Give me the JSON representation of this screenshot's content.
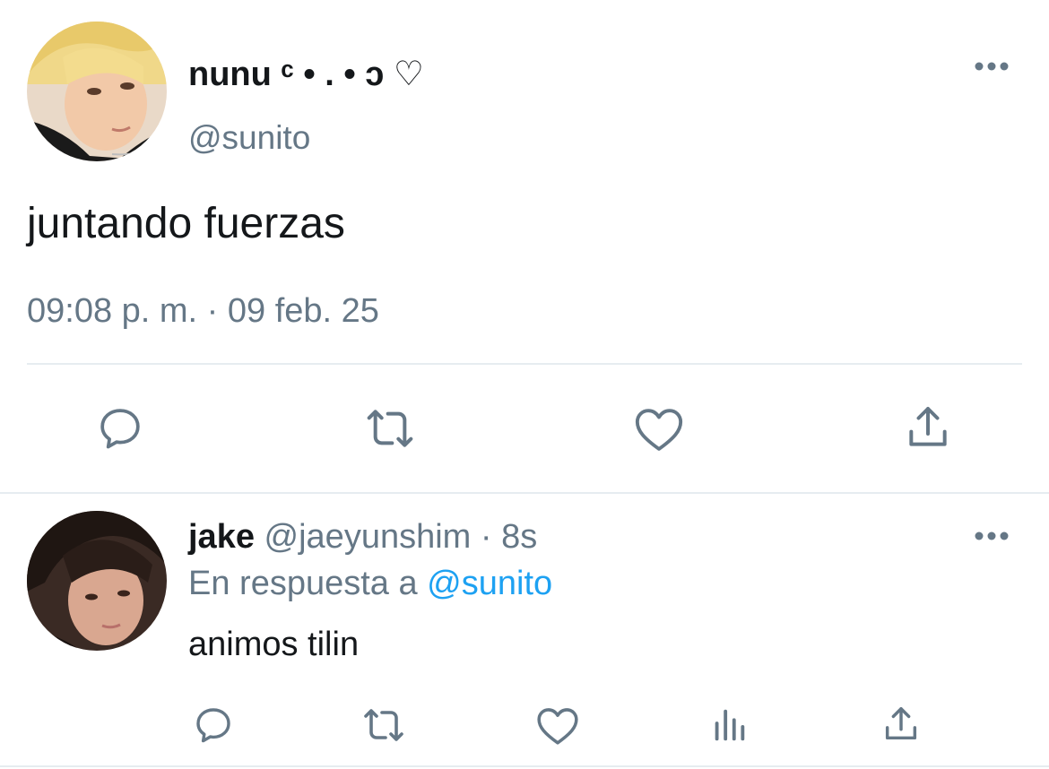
{
  "main_tweet": {
    "display_name": "nunu ᶜ • . • ɔ ♡",
    "handle": "@sunito",
    "text": "juntando fuerzas",
    "timestamp": "09:08 p. m. · 09 feb. 25",
    "actions": {
      "reply_icon": "reply-icon",
      "retweet_icon": "retweet-icon",
      "like_icon": "heart-icon",
      "share_icon": "share-icon"
    }
  },
  "reply_tweet": {
    "display_name": "jake",
    "handle": "@jaeyunshim",
    "separator": "·",
    "time_ago": "8s",
    "reply_to_prefix": "En respuesta a",
    "reply_to_handle": "@sunito",
    "text": "animos tilin",
    "actions": {
      "reply_icon": "reply-icon",
      "retweet_icon": "retweet-icon",
      "like_icon": "heart-icon",
      "analytics_icon": "analytics-icon",
      "share_icon": "share-icon"
    }
  },
  "colors": {
    "text": "#14171a",
    "muted": "#657786",
    "link": "#1da1f2",
    "divider": "#e6ecf0"
  }
}
